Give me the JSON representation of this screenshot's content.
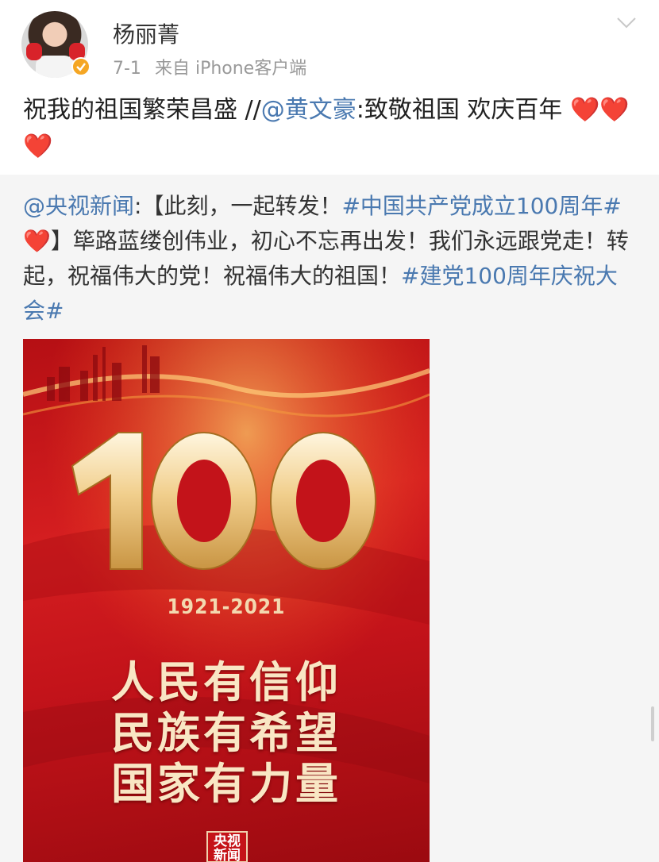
{
  "post": {
    "author": "杨丽菁",
    "time": "7-1",
    "source_prefix": "来自",
    "source": "iPhone客户端",
    "text_main": "祝我的祖国繁荣昌盛 //",
    "mention": "@黄文豪",
    "text_after": ":致敬祖国 欢庆百年",
    "hearts": "❤️❤️❤️"
  },
  "repost": {
    "mention": "@央视新闻",
    "colon": ":【此刻，一起转发！",
    "topic1": "#中国共产党成立100周年#",
    "heart": "❤️",
    "body": "】筚路蓝缕创伟业，初心不忘再出发！我们永远跟党走！转起，祝福伟大的党！祝福伟大的祖国！",
    "topic2": "#建党100周年庆祝大会#"
  },
  "poster": {
    "number": "100",
    "years": "1921-2021",
    "line1": "人民有信仰",
    "line2": "民族有希望",
    "line3": "国家有力量",
    "logo_line1": "央视",
    "logo_line2": "新闻"
  },
  "icons": {
    "menu": "chevron-down-icon",
    "badge": "verified-badge-icon"
  },
  "colors": {
    "link": "#4a79b0",
    "heart": "#e53a31",
    "poster_red": "#c3131a",
    "badge": "#f5a623"
  }
}
